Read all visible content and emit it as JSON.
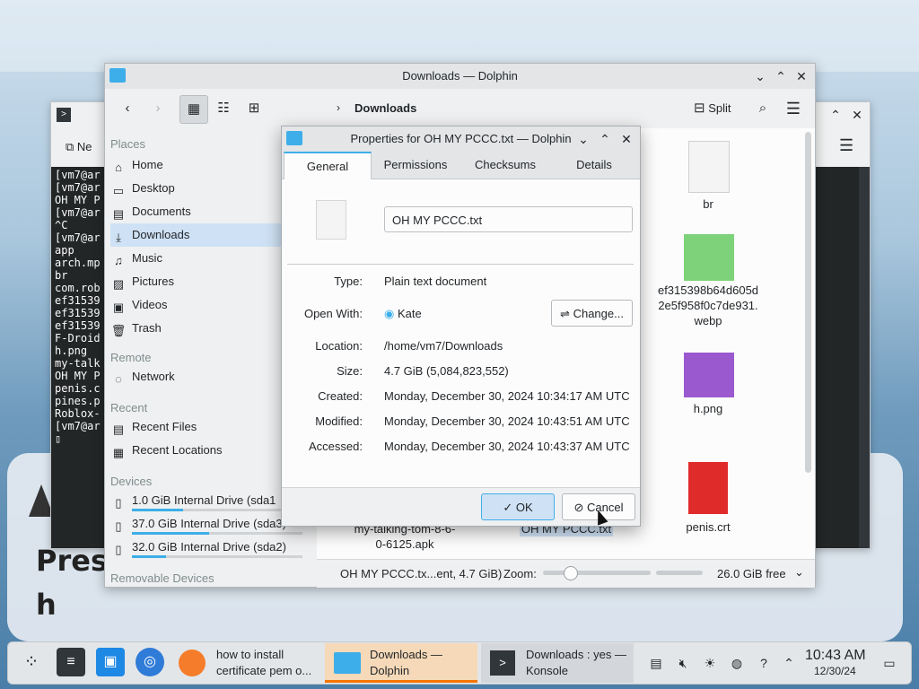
{
  "desktop": {
    "bg_text_1": "Pres",
    "bg_text_2": "h"
  },
  "konsole": {
    "new_tab_label": "Ne",
    "terminal_lines": [
      "[vm7@ar",
      "[vm7@ar",
      "OH MY P",
      "[vm7@ar",
      "^C",
      "[vm7@ar",
      "app",
      "arch.mp",
      "br",
      "com.rob",
      "ef31539",
      "ef31539",
      "ef31539",
      "F-Droid",
      "h.png",
      "my-talk",
      "OH MY P",
      "penis.c",
      "pines.p",
      "Roblox-",
      "[vm7@ar",
      "▯"
    ]
  },
  "dolphin": {
    "title": "Downloads — Dolphin",
    "breadcrumb": "Downloads",
    "split_label": "Split",
    "places": {
      "places_header": "Places",
      "places_items": [
        {
          "label": "Home",
          "icon": "home-icon"
        },
        {
          "label": "Desktop",
          "icon": "desktop-icon"
        },
        {
          "label": "Documents",
          "icon": "documents-icon"
        },
        {
          "label": "Downloads",
          "icon": "downloads-icon"
        },
        {
          "label": "Music",
          "icon": "music-icon"
        },
        {
          "label": "Pictures",
          "icon": "pictures-icon"
        },
        {
          "label": "Videos",
          "icon": "videos-icon"
        },
        {
          "label": "Trash",
          "icon": "trash-icon"
        }
      ],
      "remote_header": "Remote",
      "remote_items": [
        {
          "label": "Network",
          "icon": "network-icon"
        }
      ],
      "recent_header": "Recent",
      "recent_items": [
        {
          "label": "Recent Files",
          "icon": "recent-files-icon"
        },
        {
          "label": "Recent Locations",
          "icon": "recent-locations-icon"
        }
      ],
      "devices_header": "Devices",
      "devices_items": [
        {
          "label": "1.0 GiB Internal Drive (sda1",
          "usage": 0.3
        },
        {
          "label": "37.0 GiB Internal Drive (sda3)",
          "usage": 0.45
        },
        {
          "label": "32.0 GiB Internal Drive (sda2)",
          "usage": 0.2
        }
      ],
      "removable_header": "Removable Devices"
    },
    "files": {
      "br": "br",
      "webp_1": "ef315398b64d605d",
      "webp_2": "2e5f958f0c7de931.",
      "webp_3": "webp",
      "hpng": "h.png",
      "crt": "penis.crt",
      "apk_1": "my-talking-tom-8-6-",
      "apk_2": "0-6125.apk",
      "txt_selected": "OH MY PCCC.txt"
    },
    "status": {
      "selection": "OH MY PCCC.tx...ent, 4.7 GiB)",
      "zoom_label": "Zoom:",
      "zoom_level": 0.25,
      "free_space": "26.0 GiB free"
    }
  },
  "properties": {
    "title": "Properties for OH MY PCCC.txt — Dolphin",
    "tabs": [
      "General",
      "Permissions",
      "Checksums",
      "Details"
    ],
    "filename": "OH MY PCCC.txt",
    "rows": {
      "type_label": "Type:",
      "type_value": "Plain text document",
      "openwith_label": "Open With:",
      "openwith_value": "Kate",
      "change_label": "Change...",
      "location_label": "Location:",
      "location_value": "/home/vm7/Downloads",
      "size_label": "Size:",
      "size_value": "4.7 GiB (5,084,823,552)",
      "created_label": "Created:",
      "created_value": "Monday, December 30, 2024 10:34:17 AM UTC",
      "modified_label": "Modified:",
      "modified_value": "Monday, December 30, 2024 10:43:51 AM UTC",
      "accessed_label": "Accessed:",
      "accessed_value": "Monday, December 30, 2024 10:43:37 AM UTC"
    },
    "ok_label": "OK",
    "cancel_label": "Cancel"
  },
  "taskbar": {
    "tasks": [
      {
        "line1": "how to install",
        "line2": "certificate pem o..."
      },
      {
        "line1": "Downloads —",
        "line2": "Dolphin"
      },
      {
        "line1": "Downloads : yes —",
        "line2": "Konsole"
      }
    ],
    "clock_time": "10:43 AM",
    "clock_date": "12/30/24"
  },
  "colors": {
    "accent": "#3daee9",
    "active_task": "#f67400"
  }
}
